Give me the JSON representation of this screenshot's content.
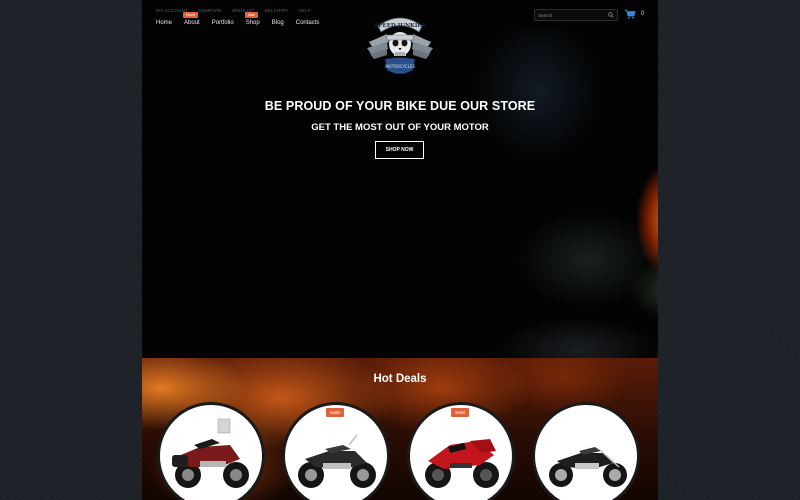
{
  "top_links": [
    "MY ACCOUNT",
    "COMPARE",
    "WISHLIST",
    "DELIVERY",
    "HELP"
  ],
  "nav": [
    {
      "label": "Home",
      "badge": ""
    },
    {
      "label": "About",
      "badge": "Hover"
    },
    {
      "label": "Portfolio",
      "badge": ""
    },
    {
      "label": "Shop",
      "badge": "Sale"
    },
    {
      "label": "Blog",
      "badge": ""
    },
    {
      "label": "Contacts",
      "badge": ""
    }
  ],
  "logo": {
    "top_text": "SPEED JUNKIES",
    "sub_text": "MOTORCYCLES"
  },
  "search": {
    "placeholder": "Search"
  },
  "cart": {
    "count": "0"
  },
  "hero": {
    "headline": "BE PROUD OF YOUR BIKE DUE OUR STORE",
    "subheadline": "GET THE MOST OUT OF YOUR MOTOR",
    "button": "SHOP NOW"
  },
  "deals": {
    "title": "Hot Deals",
    "products": [
      {
        "sale": "",
        "color": "#7a1b1b",
        "style": "touring"
      },
      {
        "sale": "Sale!",
        "color": "#2a2a2a",
        "style": "cruiser"
      },
      {
        "sale": "Sale!",
        "color": "#c2151c",
        "style": "sport"
      },
      {
        "sale": "",
        "color": "#1e1e1e",
        "style": "chopper"
      }
    ]
  },
  "colors": {
    "accent": "#e0623a",
    "site_bg": "#030303",
    "page_bg": "#1d2228"
  }
}
